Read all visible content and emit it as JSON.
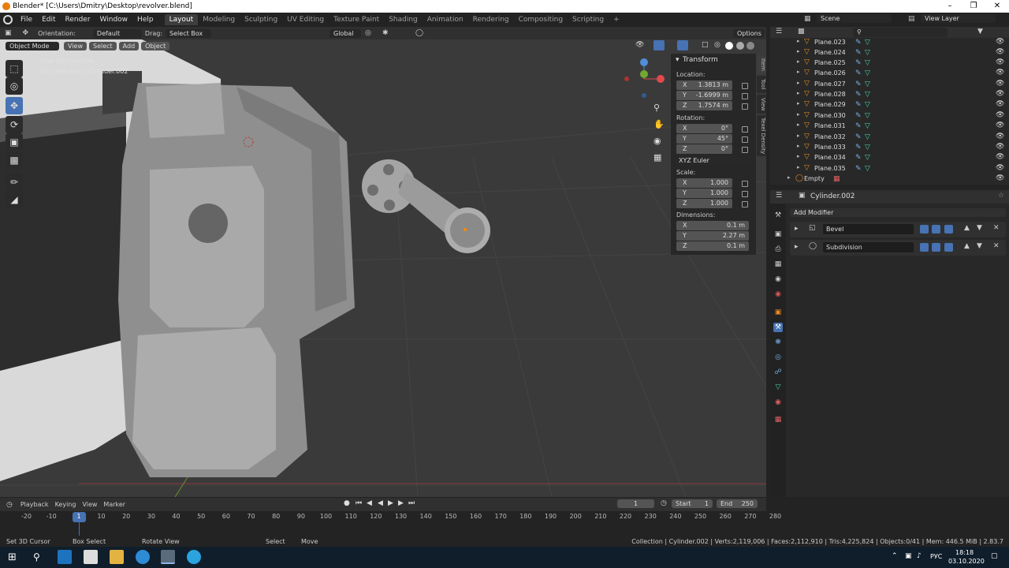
{
  "window": {
    "title": "Blender* [C:\\Users\\Dmitry\\Desktop\\revolver.blend]"
  },
  "menus": [
    "File",
    "Edit",
    "Render",
    "Window",
    "Help"
  ],
  "workspaces": [
    "Layout",
    "Modeling",
    "Sculpting",
    "UV Editing",
    "Texture Paint",
    "Shading",
    "Animation",
    "Rendering",
    "Compositing",
    "Scripting"
  ],
  "active_workspace": "Layout",
  "scene": {
    "name": "Scene",
    "view_layer": "View Layer"
  },
  "tool_header": {
    "orientation_label": "Orientation:",
    "orientation_value": "Default",
    "drag_label": "Drag:",
    "drag_value": "Select Box",
    "transform_orientation": "Global",
    "options": "Options"
  },
  "viewport_header": {
    "mode": "Object Mode",
    "menus": [
      "View",
      "Select",
      "Add",
      "Object"
    ]
  },
  "viewport": {
    "overlay_line1": "User Perspective",
    "overlay_line2": "(1) Collection | Cylinder.002"
  },
  "npanel": {
    "section": "Transform",
    "location_label": "Location:",
    "location": [
      {
        "axis": "X",
        "value": "1.3813 m"
      },
      {
        "axis": "Y",
        "value": "-1.6999 m"
      },
      {
        "axis": "Z",
        "value": "1.7574 m"
      }
    ],
    "rotation_label": "Rotation:",
    "rotation": [
      {
        "axis": "X",
        "value": "0°"
      },
      {
        "axis": "Y",
        "value": "45°"
      },
      {
        "axis": "Z",
        "value": "0°"
      }
    ],
    "rotation_mode": "XYZ Euler",
    "scale_label": "Scale:",
    "scale": [
      {
        "axis": "X",
        "value": "1.000"
      },
      {
        "axis": "Y",
        "value": "1.000"
      },
      {
        "axis": "Z",
        "value": "1.000"
      }
    ],
    "dimensions_label": "Dimensions:",
    "dimensions": [
      {
        "axis": "X",
        "value": "0.1 m"
      },
      {
        "axis": "Y",
        "value": "2.27 m"
      },
      {
        "axis": "Z",
        "value": "0.1 m"
      }
    ],
    "tabs": [
      "Item",
      "Tool",
      "View",
      "Texel Density"
    ]
  },
  "outliner": {
    "items": [
      "Plane.023",
      "Plane.024",
      "Plane.025",
      "Plane.026",
      "Plane.027",
      "Plane.028",
      "Plane.029",
      "Plane.030",
      "Plane.031",
      "Plane.032",
      "Plane.033",
      "Plane.034",
      "Plane.035"
    ],
    "empty": "Empty"
  },
  "properties": {
    "object_name": "Cylinder.002",
    "add_modifier": "Add Modifier",
    "modifiers": [
      "Bevel",
      "Subdivision"
    ]
  },
  "timeline": {
    "menus": [
      "Playback",
      "Keying",
      "View",
      "Marker"
    ],
    "current_frame": "1",
    "start_label": "Start",
    "start": "1",
    "end_label": "End",
    "end": "250",
    "ticks": [
      "-20",
      "-10",
      "1",
      "10",
      "20",
      "30",
      "40",
      "50",
      "60",
      "70",
      "80",
      "90",
      "100",
      "110",
      "120",
      "130",
      "140",
      "150",
      "160",
      "170",
      "180",
      "190",
      "200",
      "210",
      "220",
      "230",
      "240",
      "250",
      "260",
      "270",
      "280"
    ]
  },
  "statusbar": {
    "hints": [
      "Set 3D Cursor",
      "Box Select",
      "Rotate View",
      "Select",
      "Move"
    ],
    "stats": "Collection | Cylinder.002 | Verts:2,119,006 | Faces:2,112,910 | Tris:4,225,824 | Objects:0/41 | Mem: 446.5 MiB | 2.83.7"
  },
  "taskbar": {
    "lang": "РУС",
    "time": "18:18",
    "date": "03.10.2020"
  }
}
